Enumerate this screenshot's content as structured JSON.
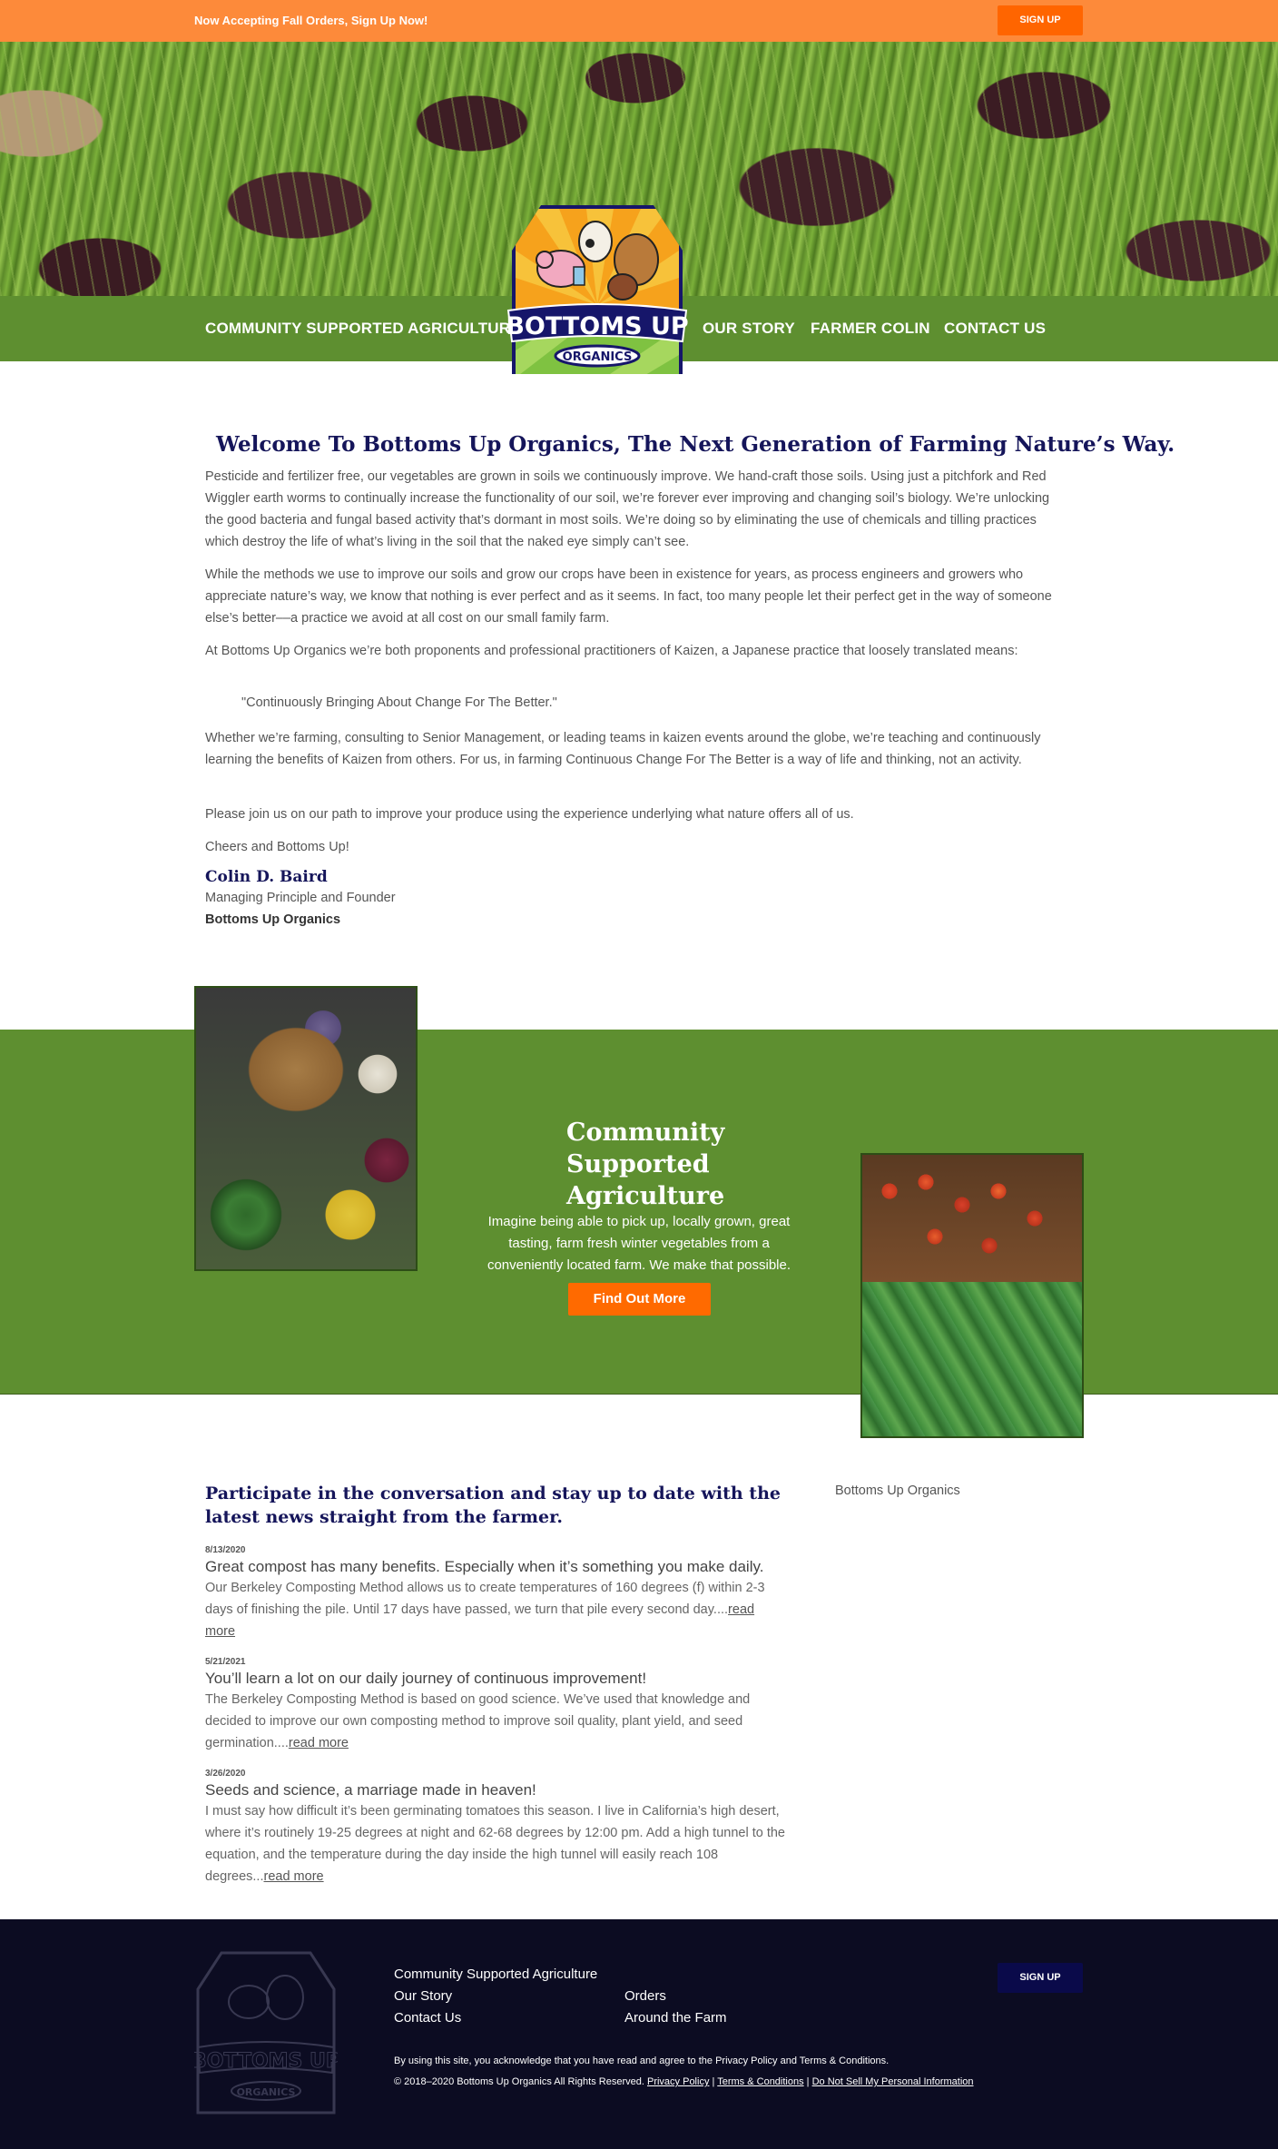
{
  "topbar": {
    "message": "Now Accepting Fall Orders, Sign Up Now!",
    "signup_label": "SIGN UP",
    "bg_color": "#fd8a3a",
    "button_color": "#ff6500"
  },
  "nav": {
    "items": [
      {
        "label": "COMMUNITY SUPPORTED AGRICULTURE"
      },
      {
        "label": "OUR STORY"
      },
      {
        "label": "FARMER COLIN"
      },
      {
        "label": "CONTACT US"
      }
    ],
    "bg_color": "#5e8f30"
  },
  "logo": {
    "text_main": "BOTTOMS UP",
    "text_sub": "ORGANICS"
  },
  "welcome": {
    "title": "Welcome To Bottoms Up Organics, The Next Generation of Farming Nature’s Way.",
    "paragraphs": [
      "Pesticide and fertilizer free, our vegetables are grown in soils we continuously improve. We hand-craft those soils. Using just a pitchfork and Red Wiggler earth worms to continually increase the functionality of our soil, we’re forever ever improving and changing soil’s biology. We’re unlocking the good bacteria and fungal based activity that’s dormant in most soils. We’re doing so by eliminating the use of chemicals and tilling practices which destroy the life of what’s living in the soil that the naked eye simply can’t see.",
      "While the methods we use to improve our soils and grow our crops have been in existence for years, as process engineers and growers who appreciate nature’s way, we know that nothing is ever perfect and as it seems. In fact, too many people let their perfect get in the way of someone else’s better––a practice we avoid at all cost on our small family farm.",
      "At Bottoms Up Organics we’re both proponents and professional practitioners of Kaizen, a Japanese practice that loosely translated means:",
      "Whether we’re farming, consulting to Senior Management, or leading teams in kaizen events around the globe, we’re teaching and continuously learning the benefits of Kaizen from others. For us, in farming Continuous Change For The Better is a way of life and thinking, not an activity.",
      "Please join us on our path to improve your produce using the experience underlying what nature offers all of us.",
      "Cheers and Bottoms Up!"
    ],
    "quote": "\"Continuously Bringing About Change For The Better.\"",
    "signature": {
      "name": "Colin D. Baird",
      "role": "Managing Principle and Founder",
      "org": "Bottoms Up Organics"
    }
  },
  "csa": {
    "title": "Community Supported Agriculture",
    "text": "Imagine being able to pick up, locally grown, great tasting, farm fresh winter vegetables from a conveniently located farm. We make that possible.",
    "button_label": "Find Out More",
    "bg_color": "#5e8f30",
    "button_color": "#ff6a00"
  },
  "blog": {
    "heading": "Participate in the conversation and stay up to date with the latest news straight from the farmer.",
    "sidebar_label": "Bottoms Up Organics",
    "posts": [
      {
        "date": "8/13/2020",
        "title": "Great compost has many benefits. Especially when it’s something you make daily.",
        "excerpt": "Our Berkeley Composting Method allows us to create temperatures of 160 degrees (f) within 2-3 days of finishing the pile. Until 17 days have passed, we turn that pile every second day....",
        "more": "read more"
      },
      {
        "date": "5/21/2021",
        "title": "You’ll learn a lot on our daily journey of continuous improvement!",
        "excerpt": "The Berkeley Composting Method is based on good science. We’ve used that knowledge and decided to improve our own composting method to improve soil quality, plant yield, and seed germination....",
        "more": "read more"
      },
      {
        "date": "3/26/2020",
        "title": "Seeds and science, a marriage made in heaven!",
        "excerpt": "I must say how difficult it’s been germinating tomatoes this season. I live in California’s high desert, where it’s routinely 19-25 degrees at night and 62-68 degrees by 12:00 pm. Add a high tunnel to the equation, and the temperature during the day inside the high tunnel will easily reach 108 degrees...",
        "more": "read more"
      }
    ]
  },
  "footer": {
    "links": [
      "Community Supported Agriculture",
      "Our Story",
      "Orders",
      "Contact Us",
      "Around the Farm"
    ],
    "signup_label": "SIGN UP",
    "disclaimer": "By using this site, you acknowledge that you have read and agree to the Privacy Policy and Terms & Conditions.",
    "copyright": "© 2018–2020 Bottoms Up Organics All Rights Reserved.",
    "legal_links": [
      "Privacy Policy",
      "Terms & Conditions",
      "Do Not Sell My Personal Information"
    ],
    "separator": "|",
    "bg_color": "#0c0c22"
  }
}
